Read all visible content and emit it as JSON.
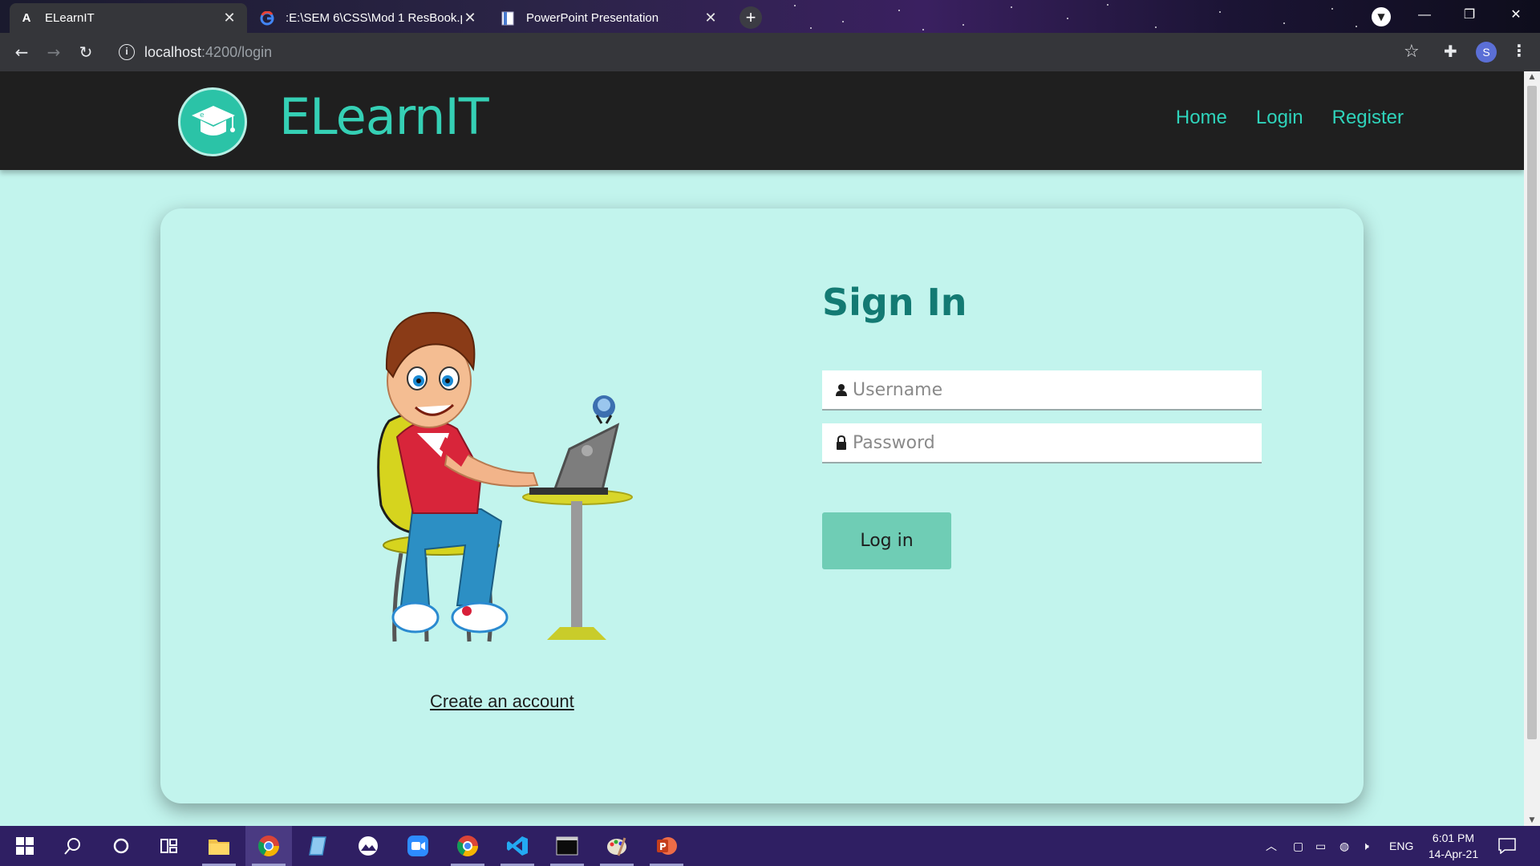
{
  "browser": {
    "tabs": [
      {
        "title": "ELearnIT",
        "favicon": "A",
        "active": true
      },
      {
        "title": ":E:\\SEM 6\\CSS\\Mod 1 ResBook.pdf",
        "favicon": "G",
        "active": false
      },
      {
        "title": "PowerPoint Presentation",
        "favicon": "doc",
        "active": false
      }
    ],
    "url_host": "localhost",
    "url_path": ":4200/login",
    "profile_initial": "S"
  },
  "site": {
    "brand": "ELearnIT",
    "nav": {
      "home": "Home",
      "login": "Login",
      "register": "Register"
    },
    "colors": {
      "accent": "#35d0b5",
      "background": "#c2f4ed",
      "title": "#137a73",
      "button": "#6fcdb5"
    }
  },
  "login": {
    "title": "Sign In",
    "username_placeholder": "Username",
    "password_placeholder": "Password",
    "button_label": "Log in",
    "create_account_label": "Create an account"
  },
  "taskbar": {
    "lang": "ENG",
    "time": "6:01 PM",
    "date": "14-Apr-21"
  }
}
